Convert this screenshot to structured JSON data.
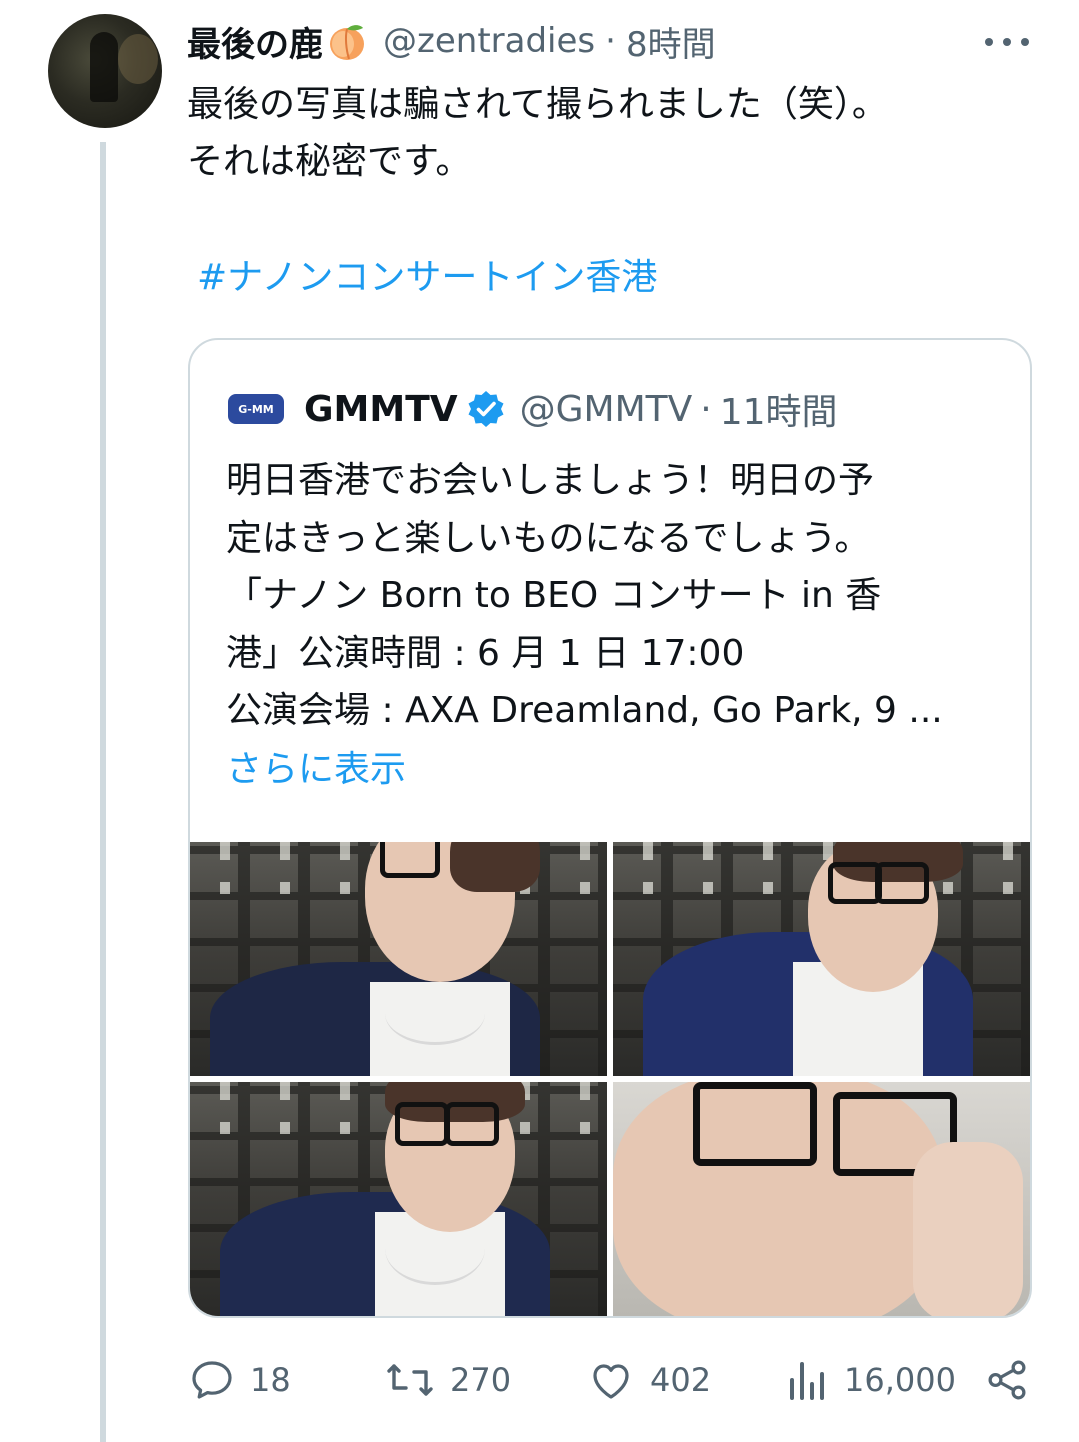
{
  "tweet": {
    "author_name": "最後の鹿",
    "author_emoji": "peach-emoji",
    "handle": "@zentradies",
    "separator": "·",
    "time": "8時間",
    "text": "最後の写真は騙されて撮られました（笑）。\nそれは秘密です。",
    "hashtag": "#ナノンコンサートイン香港"
  },
  "quote": {
    "author_name": "GMMTV",
    "logo_text": "G-MM",
    "handle": "@GMMTV",
    "separator": "·",
    "time": "11時間",
    "text": "明日香港でお会いしましょう！明日の予\n定はきっと楽しいものになるでしょう。\n「ナノン Born to BEO コンサート in 香\n港」公演時間 : 6 月 1 日 17:00\n公演会場 : AXA Dreamland, Go Park, 9 ...",
    "show_more": "さらに表示",
    "media_count": 4
  },
  "actions": {
    "replies": "18",
    "retweets": "270",
    "likes": "402",
    "views": "16,000"
  },
  "colors": {
    "accent": "#1d9bf0",
    "secondary_text": "#536471",
    "border": "#cfd9de",
    "verified": "#1d9bf0"
  }
}
